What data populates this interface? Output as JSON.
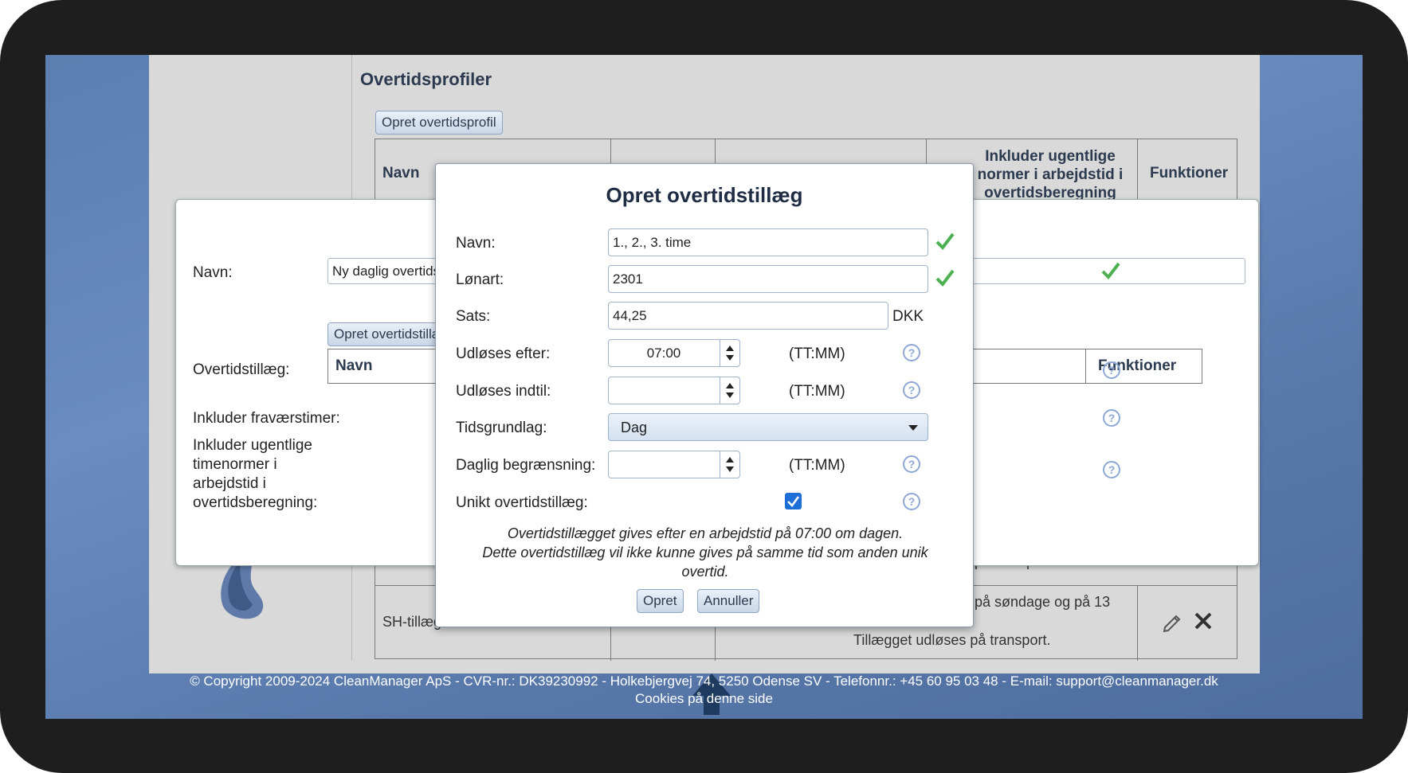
{
  "page": {
    "title": "Overtidsprofiler",
    "create_profile_button": "Opret overtidsprofil",
    "table_headers": {
      "name": "Navn",
      "include_weekly": "Inkluder ugentlige\nnormer i arbejdstid i\novertidsberegning",
      "functions": "Funktioner"
    },
    "row_partial_text": "på transport.",
    "row2": {
      "name": "SH-tillæg",
      "description_line1": "på søndage og på 13",
      "description_line2": "Tillægget udløses på transport."
    }
  },
  "profile_dialog": {
    "name_label": "Navn:",
    "name_value": "Ny daglig overtidsprofil",
    "supplement_label": "Overtidstillæg:",
    "create_supplement_button": "Opret overtidstillæg",
    "table_name_header": "Navn",
    "table_functions_header": "Funktioner",
    "include_absence_label": "Inkluder fraværstimer:",
    "include_weekly_label": "Inkluder ugentlige timenormer i arbejdstid i overtidsberegning:"
  },
  "supplement_dialog": {
    "title": "Opret overtidstillæg",
    "fields": {
      "name": {
        "label": "Navn:",
        "value": "1., 2., 3. time"
      },
      "wage_type": {
        "label": "Lønart:",
        "value": "2301"
      },
      "rate": {
        "label": "Sats:",
        "value": "44,25",
        "unit": "DKK"
      },
      "triggered_after": {
        "label": "Udløses efter:",
        "value": "07:00",
        "unit": "(TT:MM)"
      },
      "triggered_until": {
        "label": "Udløses indtil:",
        "value": "",
        "unit": "(TT:MM)"
      },
      "time_basis": {
        "label": "Tidsgrundlag:",
        "value": "Dag"
      },
      "daily_limit": {
        "label": "Daglig begrænsning:",
        "value": "",
        "unit": "(TT:MM)"
      },
      "unique": {
        "label": "Unikt overtidstillæg:",
        "checked": true
      }
    },
    "info_line1": "Overtidstillægget gives efter en arbejdstid på 07:00 om dagen.",
    "info_line2": "Dette overtidstillæg vil ikke kunne gives på samme tid som anden unik overtid.",
    "create_button": "Opret",
    "cancel_button": "Annuller"
  },
  "footer": {
    "copyright": "© Copyright 2009-2024 CleanManager ApS - CVR-nr.: DK39230992 - Holkebjergvej 74, 5250 Odense SV - Telefonnr.: +45 60 95 03 48 - E-mail: support@cleanmanager.dk",
    "cookies": "Cookies på denne side"
  },
  "colors": {
    "check_green": "#4caf50",
    "help_blue": "#8ea8d6",
    "checkbox_blue": "#1e6ed8",
    "arrow_navy": "#1f3a5f"
  }
}
